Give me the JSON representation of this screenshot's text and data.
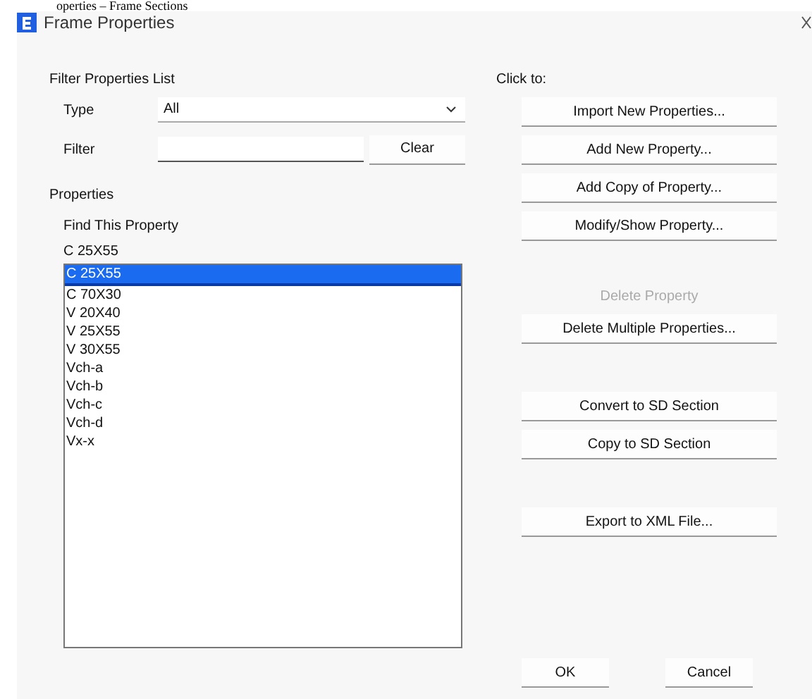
{
  "page_caption": "operties – Frame Sections",
  "window": {
    "title": "Frame Properties"
  },
  "filter": {
    "heading": "Filter Properties List",
    "type_label": "Type",
    "type_value": "All",
    "filter_label": "Filter",
    "clear_button": "Clear"
  },
  "properties": {
    "heading": "Properties",
    "find_label": "Find This Property",
    "find_value": "C 25X55",
    "items": [
      {
        "label": "C 25X55",
        "selected": true
      },
      {
        "label": "C 70X30",
        "selected": false
      },
      {
        "label": "V 20X40",
        "selected": false
      },
      {
        "label": "V 25X55",
        "selected": false
      },
      {
        "label": "V 30X55",
        "selected": false
      },
      {
        "label": "Vch-a",
        "selected": false
      },
      {
        "label": "Vch-b",
        "selected": false
      },
      {
        "label": "Vch-c",
        "selected": false
      },
      {
        "label": "Vch-d",
        "selected": false
      },
      {
        "label": "Vx-x",
        "selected": false
      }
    ]
  },
  "actions": {
    "heading": "Click to:",
    "groups": [
      [
        {
          "label": "Import New Properties...",
          "disabled": false
        },
        {
          "label": "Add New Property...",
          "disabled": false
        },
        {
          "label": "Add Copy of Property...",
          "disabled": false
        },
        {
          "label": "Modify/Show Property...",
          "disabled": false
        }
      ],
      [
        {
          "label": "Delete Property",
          "disabled": true
        },
        {
          "label": "Delete Multiple Properties...",
          "disabled": false
        }
      ],
      [
        {
          "label": "Convert to SD Section",
          "disabled": false
        },
        {
          "label": "Copy to SD Section",
          "disabled": false
        }
      ],
      [
        {
          "label": "Export to XML File...",
          "disabled": false
        }
      ]
    ]
  },
  "buttons": [
    "OK",
    "Cancel"
  ]
}
